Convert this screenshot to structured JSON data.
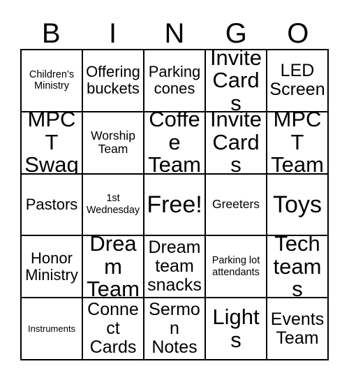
{
  "card": {
    "title": "BINGO",
    "header_letters": [
      "B",
      "I",
      "N",
      "G",
      "O"
    ],
    "free_space_label": "Free!",
    "colors": {
      "grid_line": "#000000",
      "text": "#000000",
      "background": "#ffffff"
    },
    "rows": [
      [
        {
          "text": "Children’s Ministry",
          "size": "sz-sm"
        },
        {
          "text": "Offering buckets",
          "size": "sz-lg"
        },
        {
          "text": "Parking cones",
          "size": "sz-lg"
        },
        {
          "text": "Invite Cards",
          "size": "sz-xxl"
        },
        {
          "text": "LED Screen",
          "size": "sz-xl"
        }
      ],
      [
        {
          "text": "MPCT Swag",
          "size": "sz-xxl"
        },
        {
          "text": "Worship Team",
          "size": "sz-md"
        },
        {
          "text": "Coffee Team",
          "size": "sz-xxl"
        },
        {
          "text": "Invite Cards",
          "size": "sz-xxl"
        },
        {
          "text": "MPCT Team",
          "size": "sz-xxl"
        }
      ],
      [
        {
          "text": "Pastors",
          "size": "sz-lg"
        },
        {
          "text": "1st Wednesday",
          "size": "sz-sm"
        },
        {
          "text": "Free!",
          "size": "sz-free"
        },
        {
          "text": "Greeters",
          "size": "sz-md"
        },
        {
          "text": "Toys",
          "size": "sz-free"
        }
      ],
      [
        {
          "text": "Honor Ministry",
          "size": "sz-lg"
        },
        {
          "text": "Dream Team",
          "size": "sz-xxl"
        },
        {
          "text": "Dream team snacks",
          "size": "sz-xl"
        },
        {
          "text": "Parking lot attendants",
          "size": "sz-sm"
        },
        {
          "text": "Tech teams",
          "size": "sz-xxl"
        }
      ],
      [
        {
          "text": "Instruments",
          "size": "sz-xs"
        },
        {
          "text": "Connect Cards",
          "size": "sz-xl"
        },
        {
          "text": "Sermon Notes",
          "size": "sz-xl"
        },
        {
          "text": "Lights",
          "size": "sz-xxl"
        },
        {
          "text": "Events Team",
          "size": "sz-xl"
        }
      ]
    ]
  }
}
